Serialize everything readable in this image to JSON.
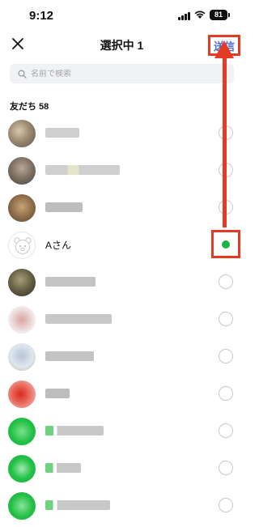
{
  "status": {
    "time": "9:12",
    "battery": "81"
  },
  "header": {
    "title": "選択中 1",
    "send_label": "送信"
  },
  "search": {
    "placeholder": "名前で検索"
  },
  "friends": {
    "header": "友だち 58",
    "items": [
      {
        "name": "",
        "selected": false
      },
      {
        "name": "",
        "selected": false
      },
      {
        "name": "",
        "selected": false
      },
      {
        "name": "Aさん",
        "selected": true
      },
      {
        "name": "",
        "selected": false
      },
      {
        "name": "",
        "selected": false
      },
      {
        "name": "",
        "selected": false
      },
      {
        "name": "",
        "selected": false
      },
      {
        "name": "",
        "selected": false
      },
      {
        "name": "",
        "selected": false
      },
      {
        "name": "",
        "selected": false
      }
    ]
  },
  "colors": {
    "accent_green": "#1db446",
    "annotation_red": "#e53a24",
    "send_blue": "#4d6fd1"
  },
  "icons": {
    "close": "close-icon",
    "search": "search-icon",
    "wifi": "wifi-icon",
    "signal": "signal-icon"
  }
}
